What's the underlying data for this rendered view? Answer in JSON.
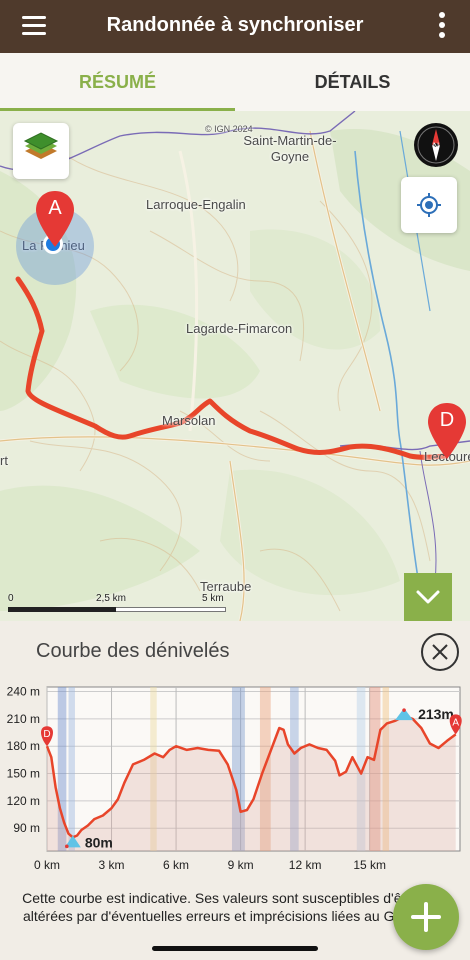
{
  "header": {
    "title": "Randonnée à synchroniser",
    "menu_icon": "hamburger-icon",
    "more_icon": "kebab-icon"
  },
  "tabs": [
    {
      "label": "RÉSUMÉ",
      "active": true
    },
    {
      "label": "DÉTAILS",
      "active": false
    }
  ],
  "map": {
    "attribution": "© IGN 2024",
    "places": [
      "Saint-Martin-de-Goyne",
      "Larroque-Engalin",
      "La Romieu",
      "Lagarde-Fimarcon",
      "Marsolan",
      "Lectoure",
      "Terraube",
      "rt"
    ],
    "start_marker": "A",
    "end_marker": "D",
    "scale": {
      "labels": [
        "0",
        "2,5 km",
        "5 km"
      ]
    },
    "compass_icon": "compass-icon",
    "layers_icon": "layers-icon",
    "locate_icon": "locate-icon",
    "collapse_icon": "chevron-down-icon",
    "colors": {
      "track": "#e8452a",
      "accent": "#8ab04a",
      "marker": "#e53935"
    }
  },
  "elevation": {
    "title": "Courbe des dénivelés",
    "close_icon": "close-icon",
    "min_label": "80m",
    "max_label": "213m",
    "start_marker": "D",
    "end_marker": "A",
    "disclaimer": "Cette courbe est indicative. Ses valeurs sont susceptibles d'être altérées par d'éventuelles erreurs et imprécisions liées au GPS."
  },
  "chart_data": {
    "type": "area",
    "title": "Courbe des dénivelés",
    "xlabel": "",
    "ylabel": "",
    "x_unit": "km",
    "y_unit": "m",
    "xlim": [
      0,
      19.2
    ],
    "ylim": [
      65,
      245
    ],
    "x_ticks": [
      "0 km",
      "3 km",
      "6 km",
      "9 km",
      "12 km",
      "15 km"
    ],
    "y_ticks": [
      "90 m",
      "120 m",
      "150 m",
      "180 m",
      "210 m",
      "240 m"
    ],
    "grid": true,
    "series": [
      {
        "x": [
          0,
          0.2,
          0.4,
          0.6,
          0.8,
          1.0,
          1.2,
          1.4,
          1.6,
          1.9,
          2.2,
          2.6,
          3.0,
          3.3,
          3.6,
          4.0,
          4.5,
          5.0,
          5.4,
          5.7,
          6.0,
          6.5,
          7.0,
          7.5,
          8.0,
          8.4,
          8.8,
          9.0,
          9.3,
          9.6,
          10.0,
          10.4,
          10.8,
          11.0,
          11.2,
          11.5,
          11.8,
          12.2,
          12.6,
          13.0,
          13.4,
          13.6,
          13.9,
          14.2,
          14.6,
          14.9,
          15.2,
          15.5,
          15.8,
          16.2,
          16.6,
          17.0,
          17.4,
          17.8,
          18.2,
          18.6,
          19.0
        ],
        "y": [
          180,
          168,
          135,
          112,
          96,
          84,
          80,
          82,
          88,
          93,
          100,
          104,
          112,
          122,
          140,
          160,
          165,
          172,
          168,
          176,
          180,
          176,
          178,
          176,
          175,
          160,
          132,
          108,
          110,
          122,
          150,
          175,
          200,
          198,
          182,
          172,
          178,
          182,
          178,
          176,
          164,
          148,
          152,
          168,
          150,
          168,
          165,
          198,
          205,
          208,
          213,
          210,
          200,
          183,
          178,
          186,
          193
        ]
      }
    ]
  }
}
